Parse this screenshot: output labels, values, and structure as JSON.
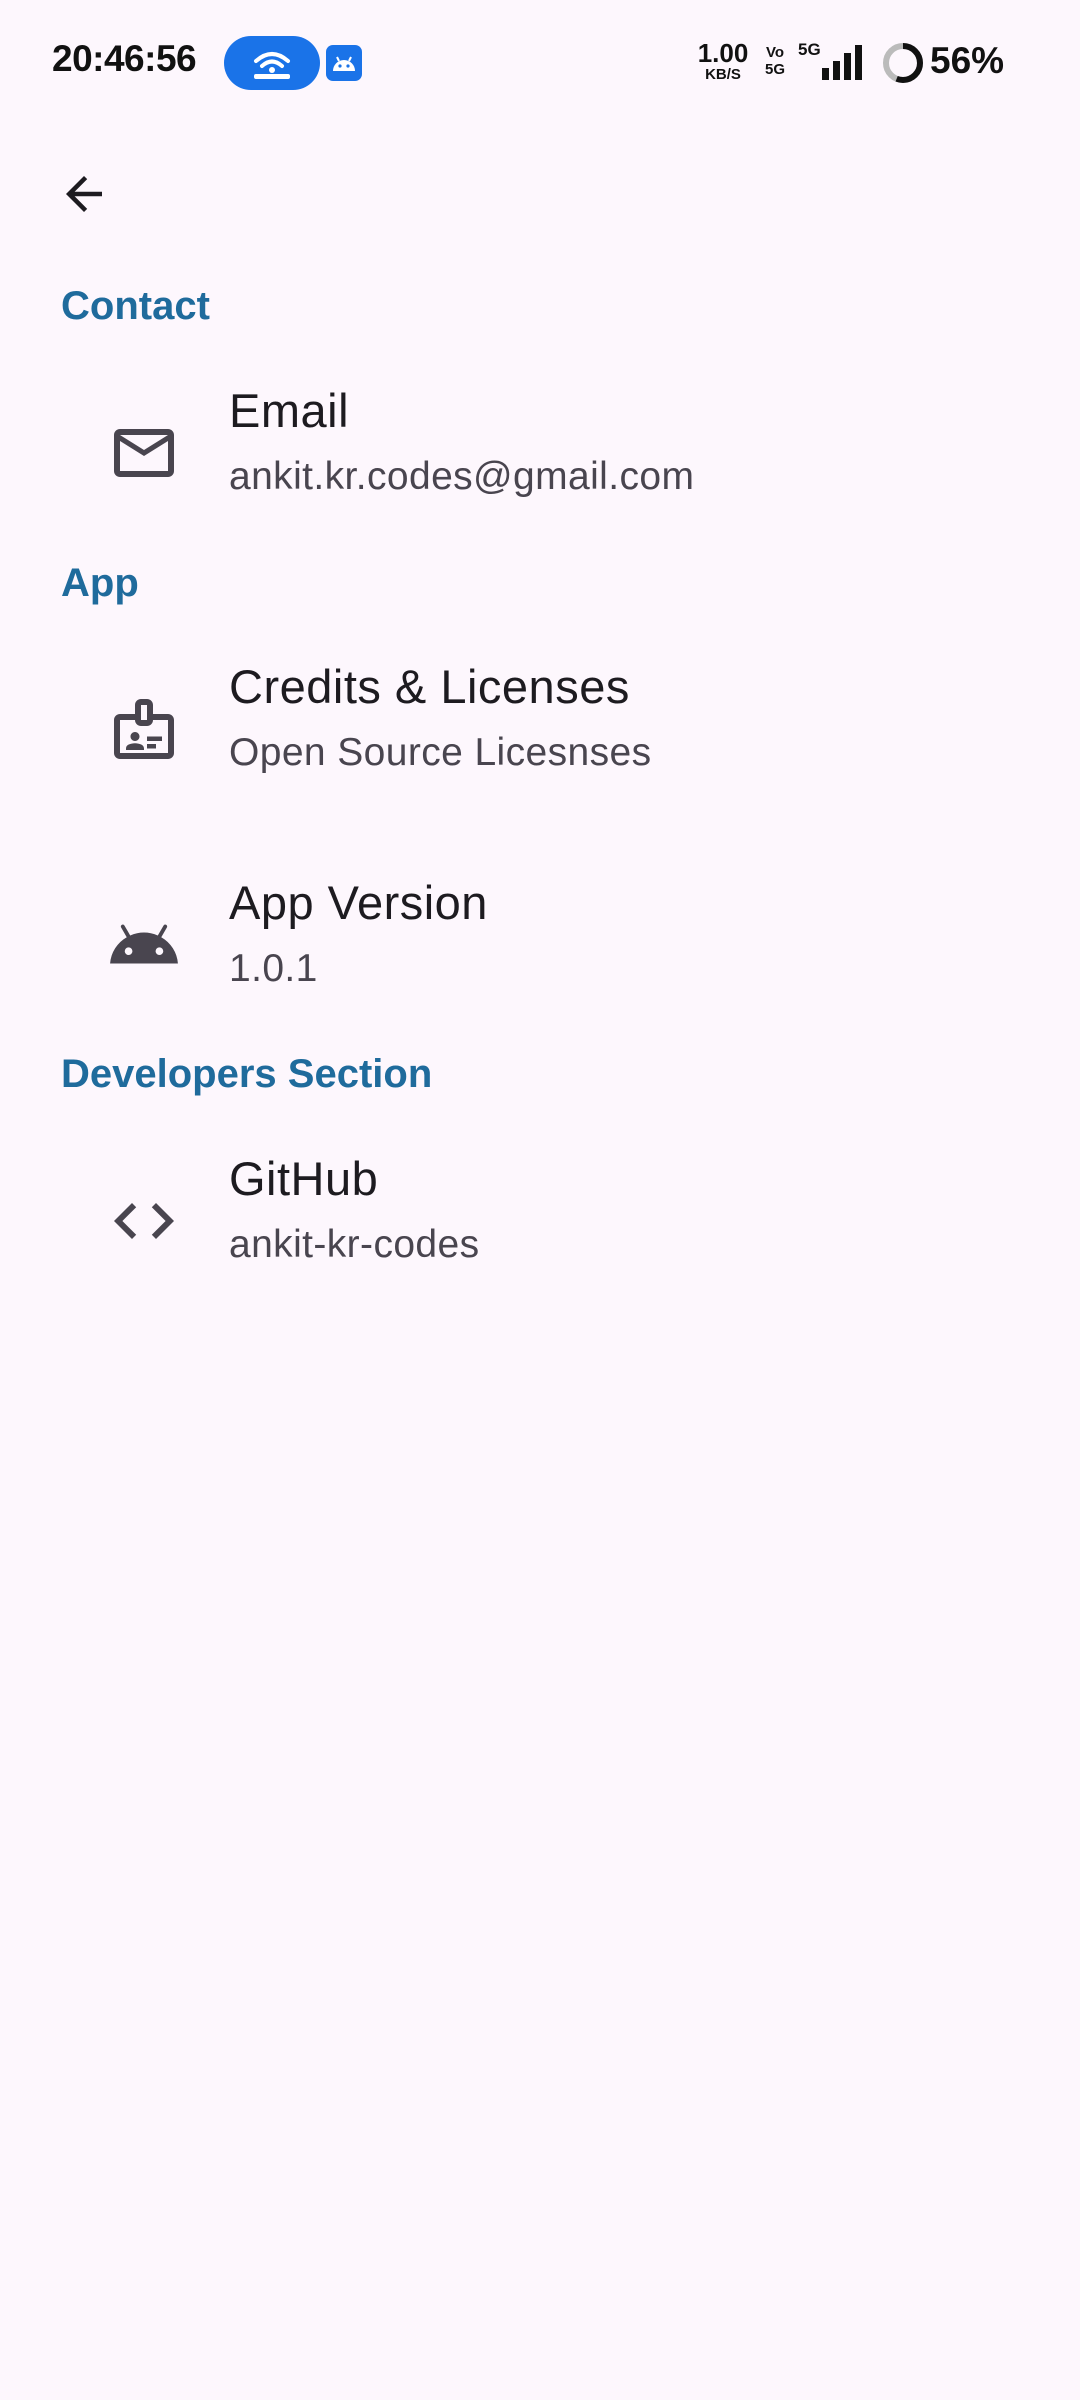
{
  "status_bar": {
    "time": "20:46:56",
    "net_speed_value": "1.00",
    "net_speed_unit": "KB/S",
    "volte_top": "Vo",
    "volte_bottom": "5G",
    "network_type": "5G",
    "battery_percent": "56%",
    "battery_level": 0.56
  },
  "app_bar": {
    "back_icon": "arrow-back-icon"
  },
  "sections": [
    {
      "header": "Contact",
      "items": [
        {
          "icon": "mail-icon",
          "title": "Email",
          "subtitle": "ankit.kr.codes@gmail.com"
        }
      ]
    },
    {
      "header": "App",
      "items": [
        {
          "icon": "badge-icon",
          "title": "Credits & Licenses",
          "subtitle": "Open Source Licesnses"
        },
        {
          "icon": "android-icon",
          "title": "App Version",
          "subtitle": "1.0.1"
        }
      ]
    },
    {
      "header": "Developers Section",
      "items": [
        {
          "icon": "code-icon",
          "title": "GitHub",
          "subtitle": "ankit-kr-codes"
        }
      ]
    }
  ],
  "colors": {
    "background": "#fdf7fd",
    "section_header": "#1f6b9c",
    "title_text": "#1d1b20",
    "subtitle_text": "#49454f",
    "icon": "#49454f",
    "status_pill": "#1a73e8"
  }
}
